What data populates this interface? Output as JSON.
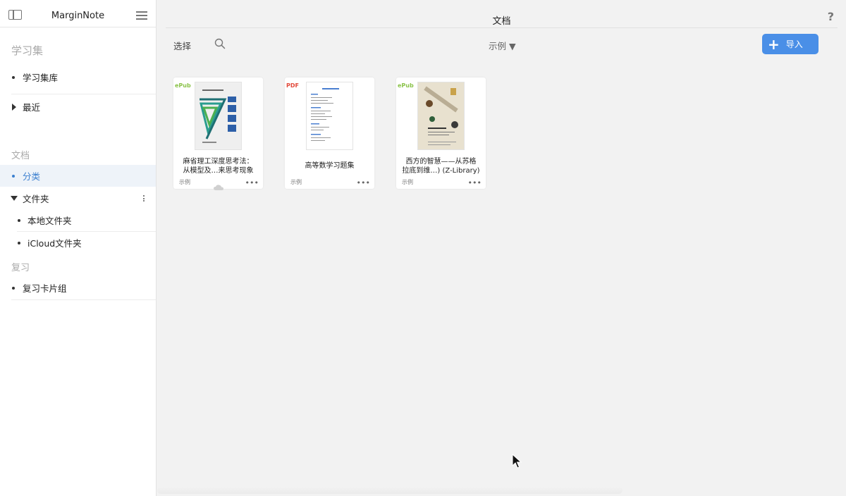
{
  "sidebar": {
    "app_title": "MarginNote",
    "section_study": "学习集",
    "study_library": "学习集库",
    "recent": "最近",
    "section_docs": "文档",
    "category": "分类",
    "folders": "文件夹",
    "local_folder": "本地文件夹",
    "icloud_folder": "iCloud文件夹",
    "section_review": "复习",
    "review_deck": "复习卡片组"
  },
  "main": {
    "title": "文档",
    "help": "?",
    "select_label": "选择",
    "sort_label": "示例 ▼",
    "import_label": "导入"
  },
  "documents": [
    {
      "type": "ePub",
      "name_line1": "麻省理工深度思考法：",
      "name_line2": "从模型及…来思考现象",
      "label": "示例"
    },
    {
      "type": "PDF",
      "name_line1": "高等数学习题集",
      "name_line2": "",
      "label": "示例"
    },
    {
      "type": "ePub",
      "name_line1": "西方的智慧——从苏格",
      "name_line2": "拉底到维…) (Z-Library)",
      "label": "示例"
    }
  ],
  "colors": {
    "accent": "#4a8fe7",
    "active_bg": "#eef3f9",
    "epub": "#8bc34a",
    "pdf": "#e24a3b"
  }
}
